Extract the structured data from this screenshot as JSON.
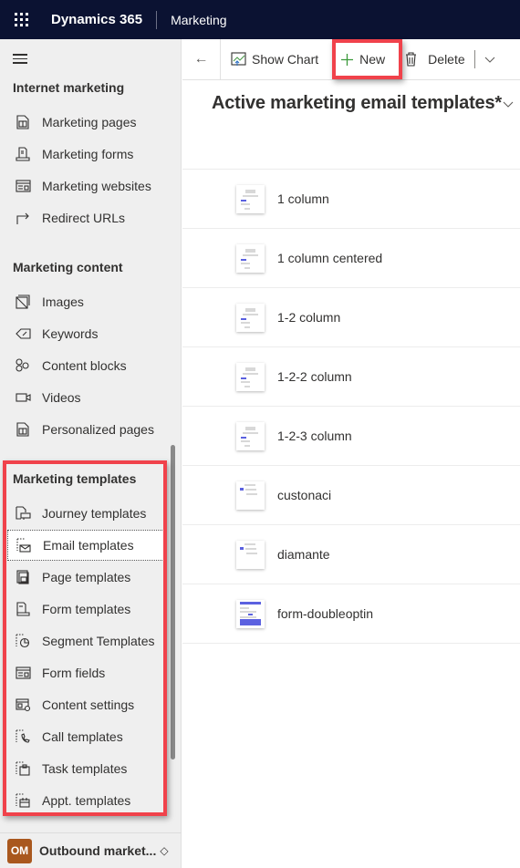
{
  "topbar": {
    "app_name": "Dynamics 365",
    "area_name": "Marketing",
    "background": "#0b1232"
  },
  "sidebar": {
    "groups": [
      {
        "title": "Internet marketing",
        "items": [
          {
            "label": "Marketing pages",
            "icon": "page-icon"
          },
          {
            "label": "Marketing forms",
            "icon": "form-icon"
          },
          {
            "label": "Marketing websites",
            "icon": "website-icon"
          },
          {
            "label": "Redirect URLs",
            "icon": "redirect-icon"
          }
        ]
      },
      {
        "title": "Marketing content",
        "items": [
          {
            "label": "Images",
            "icon": "image-icon"
          },
          {
            "label": "Keywords",
            "icon": "tag-icon"
          },
          {
            "label": "Content blocks",
            "icon": "content-blocks-icon"
          },
          {
            "label": "Videos",
            "icon": "video-icon"
          },
          {
            "label": "Personalized pages",
            "icon": "page-icon"
          }
        ]
      },
      {
        "title": "Marketing templates",
        "items": [
          {
            "label": "Journey templates",
            "icon": "journey-template-icon"
          },
          {
            "label": "Email templates",
            "icon": "email-template-icon",
            "selected": true
          },
          {
            "label": "Page templates",
            "icon": "page-template-icon"
          },
          {
            "label": "Form templates",
            "icon": "form-template-icon"
          },
          {
            "label": "Segment Templates",
            "icon": "segment-template-icon"
          },
          {
            "label": "Form fields",
            "icon": "form-fields-icon"
          },
          {
            "label": "Content settings",
            "icon": "content-settings-icon"
          },
          {
            "label": "Call templates",
            "icon": "call-template-icon"
          },
          {
            "label": "Task templates",
            "icon": "task-template-icon"
          },
          {
            "label": "Appt. templates",
            "icon": "appointment-template-icon"
          }
        ]
      }
    ],
    "footer": {
      "avatar_initials": "OM",
      "avatar_color": "#a9581e",
      "area_label": "Outbound market...",
      "switch_glyph": "◇"
    }
  },
  "commandbar": {
    "show_chart": "Show Chart",
    "new": "New",
    "delete": "Delete"
  },
  "view": {
    "title": "Active marketing email templates*"
  },
  "templates": [
    {
      "name": "1 column",
      "thumb": "light"
    },
    {
      "name": "1 column centered",
      "thumb": "light"
    },
    {
      "name": "1-2 column",
      "thumb": "light"
    },
    {
      "name": "1-2-2 column",
      "thumb": "light"
    },
    {
      "name": "1-2-3 column",
      "thumb": "light"
    },
    {
      "name": "custonaci",
      "thumb": "minimal"
    },
    {
      "name": "diamante",
      "thumb": "minimal"
    },
    {
      "name": "form-doubleoptin",
      "thumb": "blue"
    }
  ],
  "annotations": {
    "highlight_color": "#f0424b"
  }
}
